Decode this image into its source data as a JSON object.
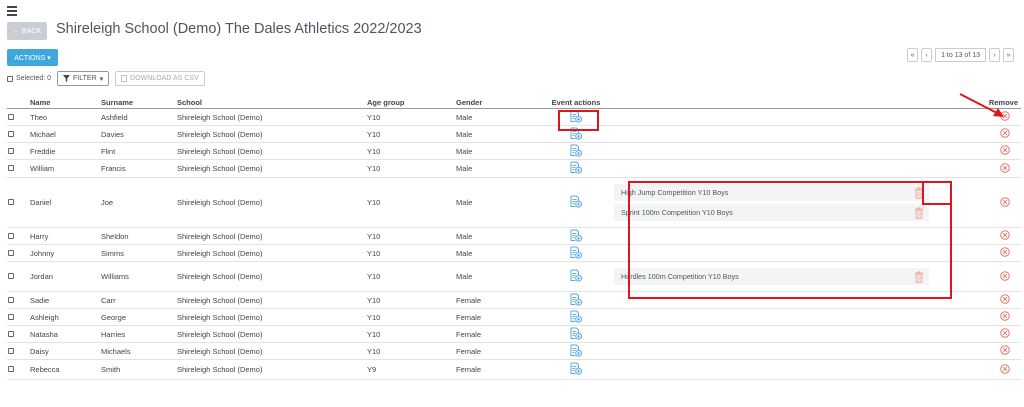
{
  "header": {
    "back_label": "← BACK",
    "title": "Shireleigh School (Demo) The Dales Athletics 2022/2023"
  },
  "toolbar": {
    "actions_label": "ACTIONS ▾",
    "selected_label": "Selected: 0",
    "filter_label": "FILTER",
    "download_label": "DOWNLOAD AS CSV"
  },
  "pagination": {
    "range": "1 to 13 of 13"
  },
  "table": {
    "columns": {
      "name": "Name",
      "surname": "Surname",
      "school": "School",
      "age_group": "Age group",
      "gender": "Gender",
      "event_actions": "Event actions",
      "remove": "Remove"
    },
    "rows": [
      {
        "name": "Theo",
        "surname": "Ashfield",
        "school": "Shireleigh School (Demo)",
        "age_group": "Y10",
        "gender": "Male",
        "events": []
      },
      {
        "name": "Michael",
        "surname": "Davies",
        "school": "Shireleigh School (Demo)",
        "age_group": "Y10",
        "gender": "Male",
        "events": []
      },
      {
        "name": "Freddie",
        "surname": "Flint",
        "school": "Shireleigh School (Demo)",
        "age_group": "Y10",
        "gender": "Male",
        "events": []
      },
      {
        "name": "William",
        "surname": "Francis",
        "school": "Shireleigh School (Demo)",
        "age_group": "Y10",
        "gender": "Male",
        "events": []
      },
      {
        "name": "Daniel",
        "surname": "Joe",
        "school": "Shireleigh School (Demo)",
        "age_group": "Y10",
        "gender": "Male",
        "events": [
          "High Jump Competition Y10 Boys",
          "Sprint 100m Competition Y10 Boys"
        ]
      },
      {
        "name": "Harry",
        "surname": "Sheldon",
        "school": "Shireleigh School (Demo)",
        "age_group": "Y10",
        "gender": "Male",
        "events": []
      },
      {
        "name": "Johnny",
        "surname": "Simms",
        "school": "Shireleigh School (Demo)",
        "age_group": "Y10",
        "gender": "Male",
        "events": []
      },
      {
        "name": "Jordan",
        "surname": "Williams",
        "school": "Shireleigh School (Demo)",
        "age_group": "Y10",
        "gender": "Male",
        "events": [
          "Hurdles 100m Competition Y10 Boys"
        ]
      },
      {
        "name": "Sadie",
        "surname": "Carr",
        "school": "Shireleigh School (Demo)",
        "age_group": "Y10",
        "gender": "Female",
        "events": []
      },
      {
        "name": "Ashleigh",
        "surname": "George",
        "school": "Shireleigh School (Demo)",
        "age_group": "Y10",
        "gender": "Female",
        "events": []
      },
      {
        "name": "Natasha",
        "surname": "Harries",
        "school": "Shireleigh School (Demo)",
        "age_group": "Y10",
        "gender": "Female",
        "events": []
      },
      {
        "name": "Daisy",
        "surname": "Michaels",
        "school": "Shireleigh School (Demo)",
        "age_group": "Y10",
        "gender": "Female",
        "events": []
      },
      {
        "name": "Rebecca",
        "surname": "Smith",
        "school": "Shireleigh School (Demo)",
        "age_group": "Y9",
        "gender": "Female",
        "events": []
      }
    ]
  },
  "colors": {
    "primary": "#3ea8dd",
    "event_icon": "#5aa9df",
    "remove_icon": "#e8756f",
    "trash_icon": "#f0a8a4",
    "annotation": "#e0141e"
  },
  "icons": {
    "event_action": "add-event-icon",
    "remove": "remove-circle-icon",
    "delete_event": "trash-icon"
  }
}
